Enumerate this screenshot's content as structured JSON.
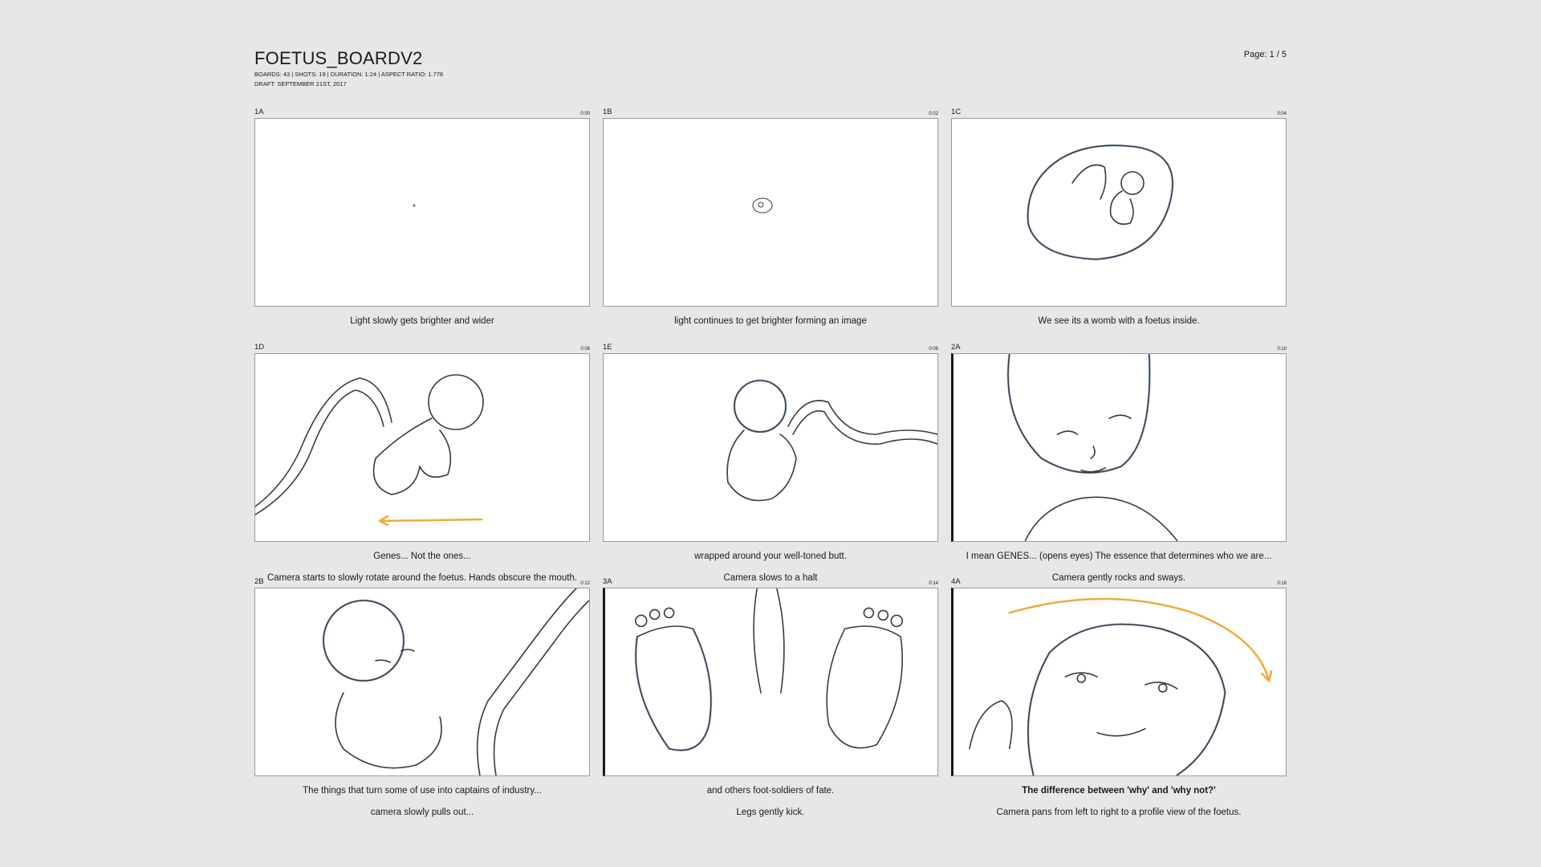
{
  "header": {
    "title": "FOETUS_BOARDV2",
    "meta_line1": "BOARDS: 43 | SHOTS: 19 | DURATION: 1:24 | ASPECT RATIO: 1.778",
    "meta_line2": "DRAFT: SEPTEMBER 21ST, 2017",
    "page": "Page: 1 / 5"
  },
  "boards": [
    {
      "id": "1A",
      "time": "0:00",
      "dialogue": "Light slowly gets brighter and wider",
      "action": ""
    },
    {
      "id": "1B",
      "time": "0:02",
      "dialogue": "light continues to get brighter forming an image",
      "action": ""
    },
    {
      "id": "1C",
      "time": "0:04",
      "dialogue": "We see its a womb with a foetus inside.",
      "action": ""
    },
    {
      "id": "1D",
      "time": "0:06",
      "dialogue": "Genes... Not the ones...",
      "action": "Camera starts to slowly rotate around the foetus. Hands obscure the mouth."
    },
    {
      "id": "1E",
      "time": "0:08",
      "dialogue": "wrapped around your well-toned butt.",
      "action": "Camera slows to a halt"
    },
    {
      "id": "2A",
      "time": "0:10",
      "dialogue": "I mean GENES... (opens eyes) The essence that determines who we are...",
      "action": "Camera gently rocks and sways."
    },
    {
      "id": "2B",
      "time": "0:12",
      "dialogue": "The things that turn some of use into captains of industry...",
      "action": "camera slowly pulls out..."
    },
    {
      "id": "3A",
      "time": "0:14",
      "dialogue": "and others foot-soldiers of fate.",
      "action": "Legs gently kick."
    },
    {
      "id": "4A",
      "time": "0:16",
      "dialogue": "The difference between 'why' and 'why not?'",
      "action": "Camera  pans from left to right to a profile view of the foetus."
    }
  ]
}
